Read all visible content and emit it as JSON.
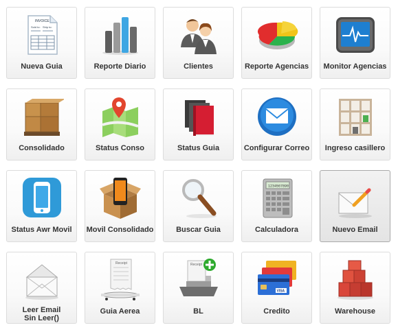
{
  "tiles": [
    {
      "label": "Nueva Guia",
      "icon": "invoice-document-icon"
    },
    {
      "label": "Reporte Diario",
      "icon": "bar-chart-icon"
    },
    {
      "label": "Clientes",
      "icon": "users-icon"
    },
    {
      "label": "Reporte Agencias",
      "icon": "pie-chart-icon"
    },
    {
      "label": "Monitor Agencias",
      "icon": "monitor-heartbeat-icon"
    },
    {
      "label": "Consolidado",
      "icon": "pallet-boxes-icon"
    },
    {
      "label": "Status Conso",
      "icon": "map-pin-icon"
    },
    {
      "label": "Status Guia",
      "icon": "books-icon"
    },
    {
      "label": "Configurar Correo",
      "icon": "mail-envelope-icon"
    },
    {
      "label": "Ingreso casillero",
      "icon": "shelf-cabinet-icon"
    },
    {
      "label": "Status Awr Movil",
      "icon": "smartphone-icon"
    },
    {
      "label": "Movil Consolidado",
      "icon": "phone-box-icon"
    },
    {
      "label": "Buscar Guia",
      "icon": "magnifier-icon"
    },
    {
      "label": "Calculadora",
      "icon": "calculator-icon"
    },
    {
      "label": "Nuevo Email",
      "icon": "envelope-pencil-icon"
    },
    {
      "label": "Leer Email\nSin Leer()",
      "icon": "open-envelope-icon"
    },
    {
      "label": "Guia Aerea",
      "icon": "airplane-receipt-icon"
    },
    {
      "label": "BL",
      "icon": "ship-receipt-icon"
    },
    {
      "label": "Credito",
      "icon": "credit-cards-icon"
    },
    {
      "label": "Warehouse",
      "icon": "warehouse-boxes-icon"
    }
  ],
  "icon_text": {
    "invoice_title": "INVOICE",
    "sold_to": "Sold to:",
    "ship_to": "Ship to:",
    "receipt": "Receipt",
    "item": "Item",
    "calc_display": "1234567890",
    "visa": "VISA"
  },
  "active_tile": 14
}
